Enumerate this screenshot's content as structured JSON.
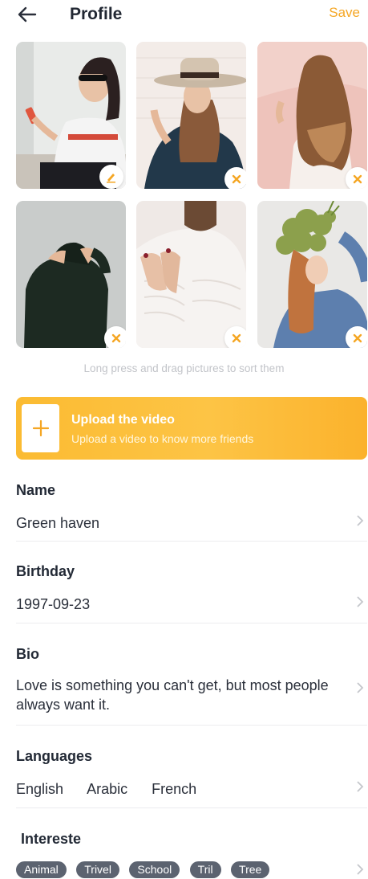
{
  "header": {
    "title": "Profile",
    "save_label": "Save"
  },
  "photos": [
    {
      "alt": "Woman in sunglasses and Regrets t-shirt",
      "badge": "edit-icon"
    },
    {
      "alt": "Woman in wide-brim hat",
      "badge": "remove-icon"
    },
    {
      "alt": "Woman with long hair from behind",
      "badge": "remove-icon"
    },
    {
      "alt": "Person covering face with dark jacket",
      "badge": "remove-icon"
    },
    {
      "alt": "Hands on white sweater",
      "badge": "remove-icon"
    },
    {
      "alt": "Woman holding plant on head",
      "badge": "remove-icon"
    }
  ],
  "hint": "Long press and drag pictures to sort them",
  "upload": {
    "title": "Upload the video",
    "subtitle": "Upload a video to know more friends"
  },
  "fields": {
    "name": {
      "label": "Name",
      "value": "Green haven"
    },
    "birthday": {
      "label": "Birthday",
      "value": "1997-09-23"
    },
    "bio": {
      "label": "Bio",
      "value": "Love is something you can't get, but most people always want it."
    },
    "languages": {
      "label": "Languages",
      "values": [
        "English",
        "Arabic",
        "French"
      ]
    },
    "interests": {
      "label": "Intereste",
      "values": [
        "Animal",
        "Trivel",
        "School",
        "Tril",
        "Tree"
      ]
    }
  },
  "colors": {
    "accent": "#f5a623",
    "chip": "#5c6370",
    "text": "#2a2f3a",
    "hint": "#c2c4c9"
  }
}
